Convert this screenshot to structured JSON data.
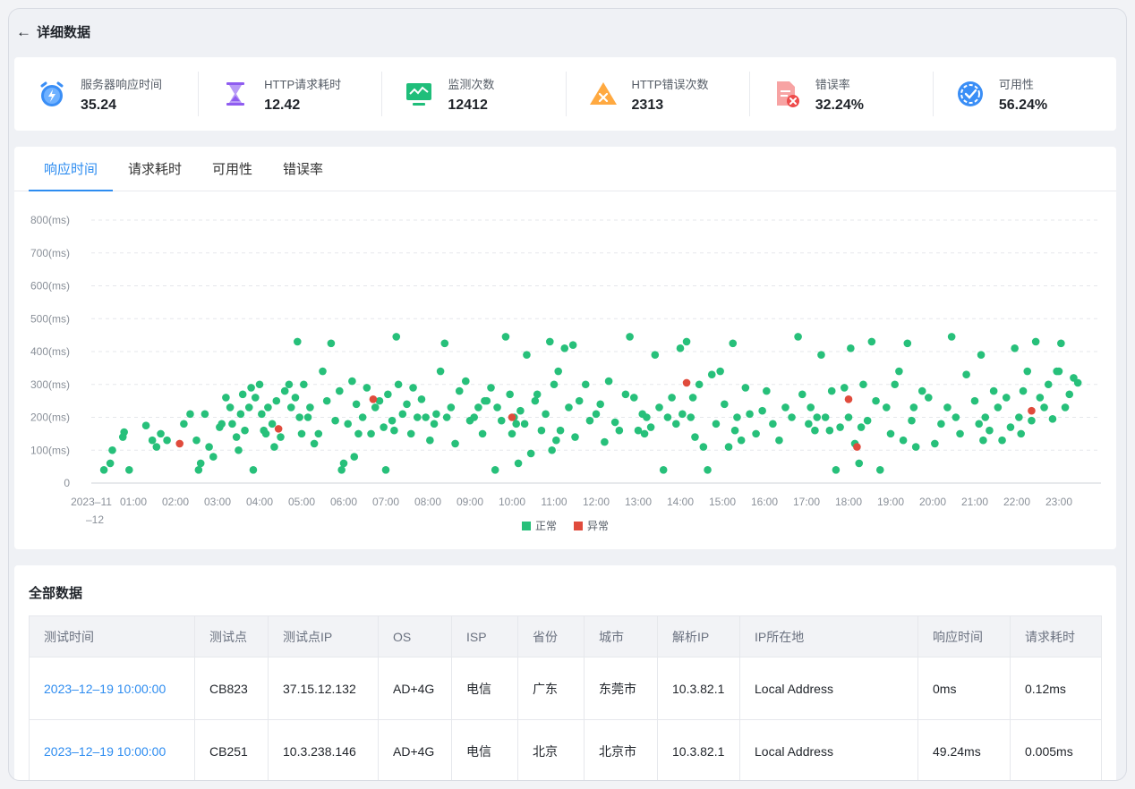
{
  "header": {
    "back_arrow": "←",
    "title": "详细数据"
  },
  "stats": [
    {
      "label": "服务器响应时间",
      "value": "35.24",
      "icon": "alarm-clock-icon",
      "color": "#3a8ef6"
    },
    {
      "label": "HTTP请求耗时",
      "value": "12.42",
      "icon": "hourglass-icon",
      "color": "#8f5cf0"
    },
    {
      "label": "监测次数",
      "value": "12412",
      "icon": "monitor-icon",
      "color": "#1fbe7a"
    },
    {
      "label": "HTTP错误次数",
      "value": "2313",
      "icon": "warning-triangle-icon",
      "color": "#ffa940"
    },
    {
      "label": "错误率",
      "value": "32.24%",
      "icon": "error-document-icon",
      "color": "#f26a6a"
    },
    {
      "label": "可用性",
      "value": "56.24%",
      "icon": "availability-badge-icon",
      "color": "#3a8ef6"
    }
  ],
  "tabs": [
    {
      "label": "响应时间",
      "active": true
    },
    {
      "label": "请求耗时",
      "active": false
    },
    {
      "label": "可用性",
      "active": false
    },
    {
      "label": "错误率",
      "active": false
    }
  ],
  "chart_data": {
    "type": "scatter",
    "xlim": [
      0,
      24
    ],
    "ylim": [
      0,
      800
    ],
    "y_ticks": [
      "0",
      "100(ms)",
      "200(ms)",
      "300(ms)",
      "400(ms)",
      "500(ms)",
      "600(ms)",
      "700(ms)",
      "800(ms)"
    ],
    "x_ticks": [
      "2023–11\n–12",
      "01:00",
      "02:00",
      "03:00",
      "04:00",
      "05:00",
      "06:00",
      "07:00",
      "08:00",
      "09:00",
      "10:00",
      "11:00",
      "12:00",
      "13:00",
      "14:00",
      "15:00",
      "16:00",
      "17:00",
      "18:00",
      "19:00",
      "20:00",
      "21:00",
      "22:00",
      "23:00"
    ],
    "grid": "horizontal dashed",
    "legend_position": "bottom-center",
    "series": [
      {
        "name": "正常",
        "color": "#27c07a",
        "points": [
          [
            0.3,
            40
          ],
          [
            0.45,
            60
          ],
          [
            0.5,
            100
          ],
          [
            0.75,
            140
          ],
          [
            0.78,
            155
          ],
          [
            0.9,
            40
          ],
          [
            1.3,
            175
          ],
          [
            1.45,
            130
          ],
          [
            1.55,
            110
          ],
          [
            1.65,
            150
          ],
          [
            1.8,
            130
          ],
          [
            2.2,
            180
          ],
          [
            2.35,
            210
          ],
          [
            2.5,
            130
          ],
          [
            2.55,
            40
          ],
          [
            2.6,
            60
          ],
          [
            2.7,
            210
          ],
          [
            2.8,
            110
          ],
          [
            2.9,
            80
          ],
          [
            3.05,
            170
          ],
          [
            3.1,
            180
          ],
          [
            3.2,
            260
          ],
          [
            3.3,
            230
          ],
          [
            3.35,
            180
          ],
          [
            3.45,
            140
          ],
          [
            3.5,
            100
          ],
          [
            3.6,
            270
          ],
          [
            3.65,
            160
          ],
          [
            3.75,
            230
          ],
          [
            3.8,
            290
          ],
          [
            3.85,
            40
          ],
          [
            3.9,
            260
          ],
          [
            4.0,
            300
          ],
          [
            4.05,
            210
          ],
          [
            4.1,
            160
          ],
          [
            4.2,
            230
          ],
          [
            4.3,
            180
          ],
          [
            4.35,
            110
          ],
          [
            4.4,
            250
          ],
          [
            4.5,
            140
          ],
          [
            4.6,
            280
          ],
          [
            4.7,
            300
          ],
          [
            4.75,
            230
          ],
          [
            4.85,
            260
          ],
          [
            4.9,
            430
          ],
          [
            4.95,
            200
          ],
          [
            5.05,
            300
          ],
          [
            5.15,
            200
          ],
          [
            5.2,
            230
          ],
          [
            5.3,
            120
          ],
          [
            5.4,
            150
          ],
          [
            5.5,
            340
          ],
          [
            5.6,
            250
          ],
          [
            5.7,
            425
          ],
          [
            5.8,
            190
          ],
          [
            5.9,
            280
          ],
          [
            5.95,
            40
          ],
          [
            6.0,
            60
          ],
          [
            6.1,
            180
          ],
          [
            6.2,
            310
          ],
          [
            6.25,
            80
          ],
          [
            6.3,
            240
          ],
          [
            6.45,
            200
          ],
          [
            6.55,
            290
          ],
          [
            6.65,
            150
          ],
          [
            6.75,
            230
          ],
          [
            6.85,
            250
          ],
          [
            6.95,
            170
          ],
          [
            7.0,
            40
          ],
          [
            7.05,
            270
          ],
          [
            7.15,
            190
          ],
          [
            7.25,
            445
          ],
          [
            7.3,
            300
          ],
          [
            7.4,
            210
          ],
          [
            7.5,
            240
          ],
          [
            7.6,
            150
          ],
          [
            7.65,
            290
          ],
          [
            7.75,
            200
          ],
          [
            7.85,
            255
          ],
          [
            7.95,
            200
          ],
          [
            8.05,
            130
          ],
          [
            8.15,
            180
          ],
          [
            8.3,
            340
          ],
          [
            8.4,
            425
          ],
          [
            8.45,
            200
          ],
          [
            8.55,
            230
          ],
          [
            8.65,
            120
          ],
          [
            8.75,
            280
          ],
          [
            8.9,
            310
          ],
          [
            9.0,
            190
          ],
          [
            9.1,
            200
          ],
          [
            9.2,
            230
          ],
          [
            9.3,
            150
          ],
          [
            9.4,
            250
          ],
          [
            9.5,
            290
          ],
          [
            9.6,
            40
          ],
          [
            9.65,
            230
          ],
          [
            9.75,
            190
          ],
          [
            9.85,
            445
          ],
          [
            9.95,
            270
          ],
          [
            10.0,
            150
          ],
          [
            10.05,
            200
          ],
          [
            10.15,
            60
          ],
          [
            10.2,
            220
          ],
          [
            10.3,
            180
          ],
          [
            10.35,
            390
          ],
          [
            10.45,
            90
          ],
          [
            10.55,
            250
          ],
          [
            10.6,
            270
          ],
          [
            10.7,
            160
          ],
          [
            10.8,
            210
          ],
          [
            10.9,
            430
          ],
          [
            10.95,
            100
          ],
          [
            11.0,
            300
          ],
          [
            11.1,
            340
          ],
          [
            11.15,
            160
          ],
          [
            11.25,
            410
          ],
          [
            11.35,
            230
          ],
          [
            11.45,
            420
          ],
          [
            11.5,
            140
          ],
          [
            11.6,
            250
          ],
          [
            11.75,
            300
          ],
          [
            11.85,
            190
          ],
          [
            12.0,
            210
          ],
          [
            12.1,
            240
          ],
          [
            12.2,
            125
          ],
          [
            12.3,
            310
          ],
          [
            12.45,
            185
          ],
          [
            12.55,
            160
          ],
          [
            12.7,
            270
          ],
          [
            12.8,
            445
          ],
          [
            12.9,
            260
          ],
          [
            13.0,
            160
          ],
          [
            13.1,
            210
          ],
          [
            13.15,
            150
          ],
          [
            13.3,
            170
          ],
          [
            13.4,
            390
          ],
          [
            13.5,
            230
          ],
          [
            13.6,
            40
          ],
          [
            13.7,
            200
          ],
          [
            13.8,
            260
          ],
          [
            13.9,
            180
          ],
          [
            14.0,
            410
          ],
          [
            14.05,
            210
          ],
          [
            14.15,
            430
          ],
          [
            14.25,
            200
          ],
          [
            14.35,
            140
          ],
          [
            14.45,
            300
          ],
          [
            14.55,
            110
          ],
          [
            14.65,
            40
          ],
          [
            14.75,
            330
          ],
          [
            14.85,
            180
          ],
          [
            14.95,
            340
          ],
          [
            15.05,
            240
          ],
          [
            15.15,
            110
          ],
          [
            15.25,
            425
          ],
          [
            15.35,
            200
          ],
          [
            15.45,
            130
          ],
          [
            15.55,
            290
          ],
          [
            15.65,
            210
          ],
          [
            15.8,
            150
          ],
          [
            15.95,
            220
          ],
          [
            16.05,
            280
          ],
          [
            16.2,
            180
          ],
          [
            16.35,
            130
          ],
          [
            16.5,
            230
          ],
          [
            16.65,
            200
          ],
          [
            16.8,
            445
          ],
          [
            16.9,
            270
          ],
          [
            17.05,
            180
          ],
          [
            17.1,
            230
          ],
          [
            17.2,
            160
          ],
          [
            17.35,
            390
          ],
          [
            17.45,
            200
          ],
          [
            17.55,
            160
          ],
          [
            17.6,
            280
          ],
          [
            17.7,
            40
          ],
          [
            17.8,
            170
          ],
          [
            17.9,
            290
          ],
          [
            18.0,
            200
          ],
          [
            18.05,
            410
          ],
          [
            18.15,
            120
          ],
          [
            18.25,
            60
          ],
          [
            18.35,
            300
          ],
          [
            18.45,
            190
          ],
          [
            18.55,
            430
          ],
          [
            18.65,
            250
          ],
          [
            18.75,
            40
          ],
          [
            18.9,
            230
          ],
          [
            19.0,
            150
          ],
          [
            19.1,
            300
          ],
          [
            19.2,
            340
          ],
          [
            19.3,
            130
          ],
          [
            19.4,
            425
          ],
          [
            19.5,
            190
          ],
          [
            19.6,
            110
          ],
          [
            19.75,
            280
          ],
          [
            19.9,
            260
          ],
          [
            20.05,
            120
          ],
          [
            20.2,
            180
          ],
          [
            20.35,
            230
          ],
          [
            20.45,
            445
          ],
          [
            20.55,
            200
          ],
          [
            20.65,
            150
          ],
          [
            20.8,
            330
          ],
          [
            21.0,
            250
          ],
          [
            21.1,
            180
          ],
          [
            21.15,
            390
          ],
          [
            21.25,
            200
          ],
          [
            21.35,
            160
          ],
          [
            21.45,
            280
          ],
          [
            21.55,
            230
          ],
          [
            21.65,
            130
          ],
          [
            21.75,
            260
          ],
          [
            21.85,
            170
          ],
          [
            21.95,
            410
          ],
          [
            22.05,
            200
          ],
          [
            22.15,
            280
          ],
          [
            22.25,
            340
          ],
          [
            22.35,
            190
          ],
          [
            22.45,
            430
          ],
          [
            22.55,
            260
          ],
          [
            22.65,
            230
          ],
          [
            22.75,
            300
          ],
          [
            22.85,
            195
          ],
          [
            22.95,
            340
          ],
          [
            23.05,
            425
          ],
          [
            23.15,
            230
          ],
          [
            23.25,
            270
          ],
          [
            23.35,
            320
          ],
          [
            23.45,
            305
          ],
          [
            23.0,
            340
          ],
          [
            3.55,
            210
          ],
          [
            4.15,
            150
          ],
          [
            5.0,
            150
          ],
          [
            6.35,
            150
          ],
          [
            7.2,
            160
          ],
          [
            8.2,
            210
          ],
          [
            9.35,
            250
          ],
          [
            10.1,
            180
          ],
          [
            11.05,
            130
          ],
          [
            13.2,
            200
          ],
          [
            14.3,
            260
          ],
          [
            15.3,
            160
          ],
          [
            17.25,
            200
          ],
          [
            18.3,
            170
          ],
          [
            19.55,
            230
          ],
          [
            21.2,
            130
          ],
          [
            22.1,
            150
          ]
        ]
      },
      {
        "name": "异常",
        "color": "#e04b3c",
        "points": [
          [
            2.1,
            120
          ],
          [
            4.45,
            165
          ],
          [
            6.7,
            255
          ],
          [
            10.0,
            200
          ],
          [
            14.15,
            305
          ],
          [
            18.0,
            255
          ],
          [
            18.2,
            110
          ],
          [
            22.35,
            220
          ]
        ]
      }
    ]
  },
  "table": {
    "title": "全部数据",
    "columns": [
      "测试时间",
      "测试点",
      "测试点IP",
      "OS",
      "ISP",
      "省份",
      "城市",
      "解析IP",
      "IP所在地",
      "响应时间",
      "请求耗时"
    ],
    "rows": [
      [
        "2023–12–19 10:00:00",
        "CB823",
        "37.15.12.132",
        "AD+4G",
        "电信",
        "广东",
        "东莞市",
        "10.3.82.1",
        "Local Address",
        "0ms",
        "0.12ms"
      ],
      [
        "2023–12–19 10:00:00",
        "CB251",
        "10.3.238.146",
        "AD+4G",
        "电信",
        "北京",
        "北京市",
        "10.3.82.1",
        "Local Address",
        "49.24ms",
        "0.005ms"
      ]
    ]
  }
}
